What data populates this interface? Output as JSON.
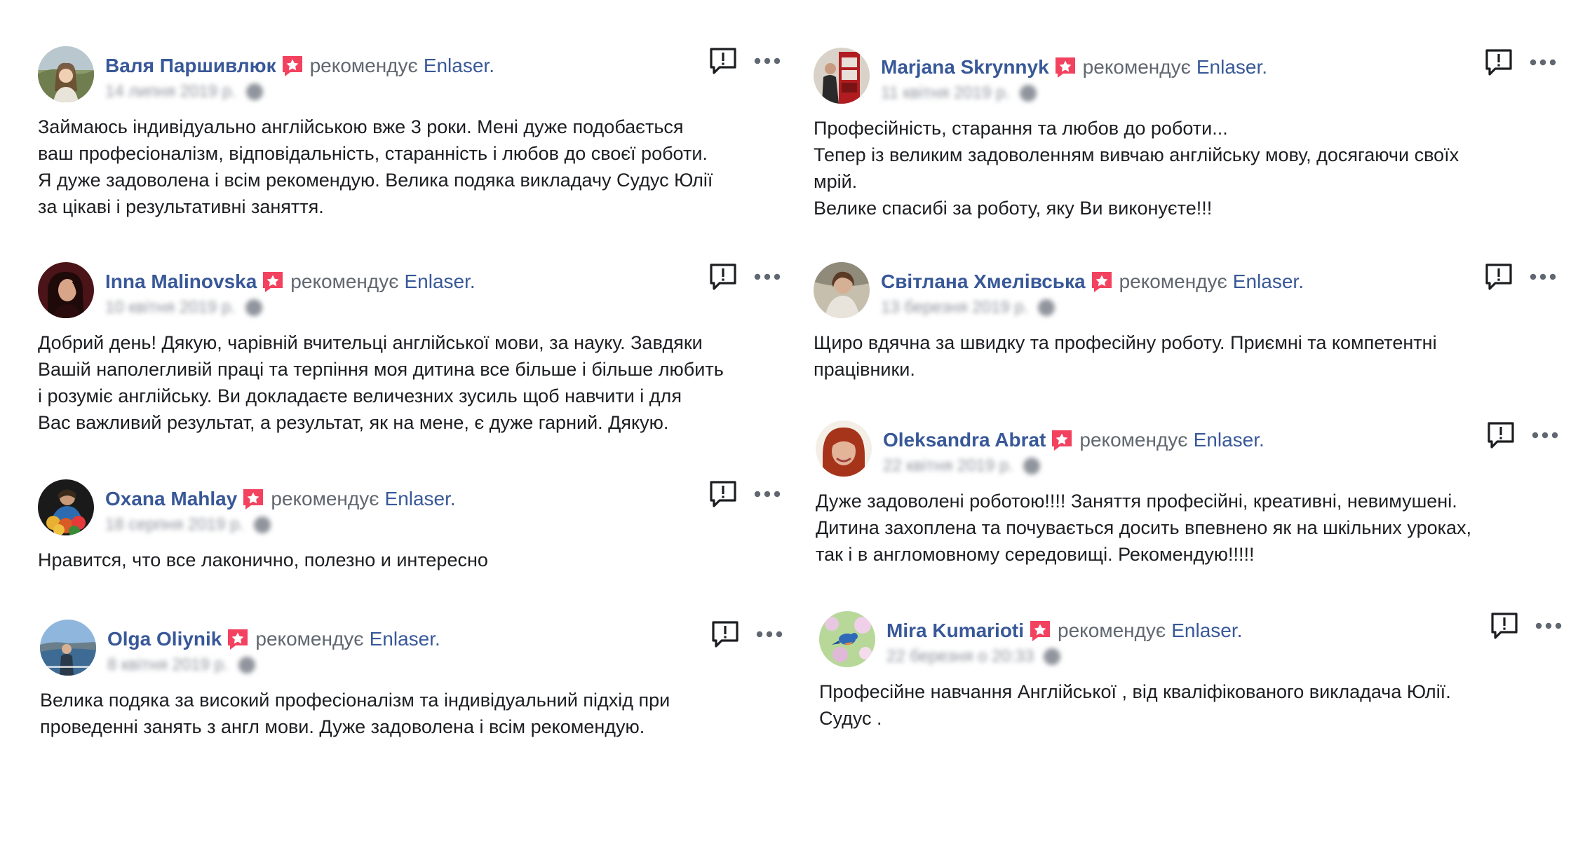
{
  "verb": "рекомендує",
  "page_name": "Enlaser.",
  "left_reviews": [
    {
      "author": "Валя Паршивлюк",
      "date": "14 липня 2019 р.",
      "text": "Займаюсь індивідуально англійською вже 3 роки. Мені дуже подобається\nваш професіоналізм, відповідальність, старанність і любов до своєї роботи.\nЯ дуже задоволена і всім рекомендую. Велика подяка викладачу Судус Юлії\nза цікаві і результативні заняття."
    },
    {
      "author": "Inna Malinovska",
      "date": "10 квітня 2019 р.",
      "text": "Добрий день! Дякую, чарівній вчительці англійської мови, за науку. Завдяки\nВашій наполегливій праці та терпіння моя дитина все більше і більше любить\nі розуміє англійську. Ви докладаєте величезних зусиль щоб навчити і для\nВас важливий результат, а результат, як на мене, є дуже гарний. Дякую."
    },
    {
      "author": "Oxana Mahlay",
      "date": "18 серпня 2019 р.",
      "text": "Нравится, что все лаконично, полезно и интересно"
    },
    {
      "author": "Olga Oliynik",
      "date": "8 квітня 2019 р.",
      "text": "Велика подяка за високий професіоналізм та індивідуальний підхід при\nпроведенні занять з англ мови. Дуже задоволена і всім рекомендую."
    }
  ],
  "right_reviews": [
    {
      "author": "Marjana Skrynnyk",
      "date": "11 квітня 2019 р.",
      "text": "Професійність, старання та любов до роботи...\nТепер із великим задоволенням вивчаю англійську мову, досягаючи своїх\nмрій.\nВелике спасибі за роботу, яку Ви виконуєте!!!"
    },
    {
      "author": "Світлана Хмелівська",
      "date": "13 березня 2019 р.",
      "text": "Щиро вдячна за швидку та професійну роботу. Приємні та компетентні\nпрацівники."
    },
    {
      "author": "Oleksandra Abrat",
      "date": "22 квітня 2019 р.",
      "text": "Дуже задоволені роботою!!!! Заняття професійні, креативні, невимушені.\nДитина захоплена та почувається досить впевнено як на шкільних уроках,\nтак і в англомовному середовищі. Рекомендую!!!!!"
    },
    {
      "author": "Mira Kumarioti",
      "date": "22 березня о 20:33",
      "text": "Професійне навчання Англійської , від кваліфікованого викладача Юлії.\nСудус ."
    }
  ],
  "colors": {
    "author_link": "#385898",
    "secondary_text": "#606770",
    "recommend_badge": "#f3425f",
    "body_text": "#1c1e21"
  },
  "icons": {
    "recommend": "recommend-star-badge-icon",
    "report": "report-speech-bubble-icon",
    "more": "more-options-dots-icon",
    "privacy": "globe-icon"
  }
}
